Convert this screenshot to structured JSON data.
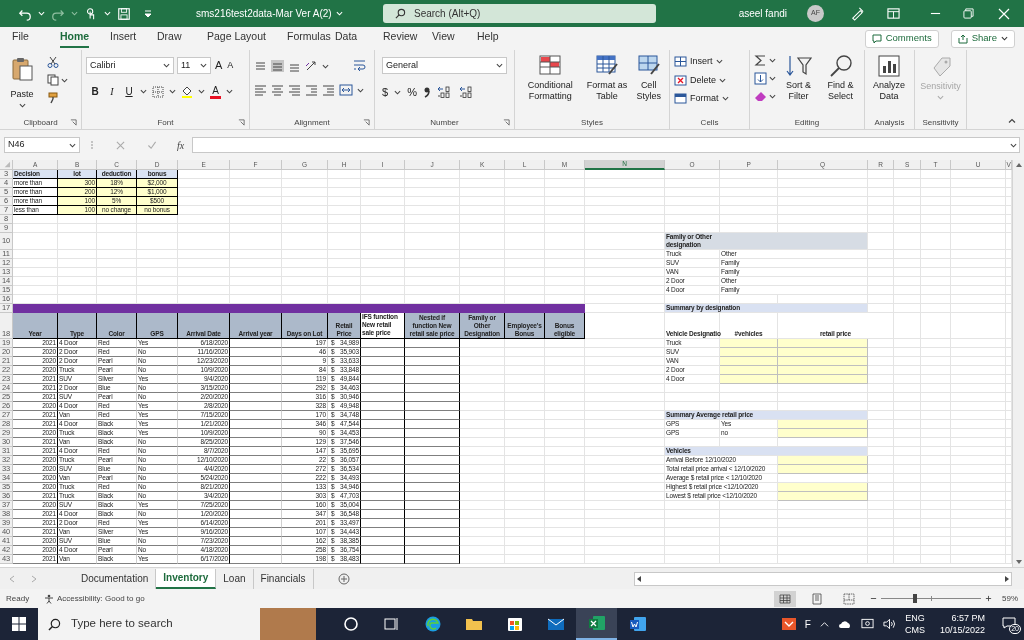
{
  "title_bar": {
    "document": "sms216test2data-Mar Ver A(2)",
    "search": "Search (Alt+Q)",
    "user": "aseel fandi",
    "initials": "AF"
  },
  "menu": [
    {
      "label": "File",
      "selected": false
    },
    {
      "label": "Home",
      "selected": true
    },
    {
      "label": "Insert",
      "selected": false
    },
    {
      "label": "Draw",
      "selected": false
    },
    {
      "label": "Page Layout",
      "selected": false
    },
    {
      "label": "Formulas",
      "selected": false
    },
    {
      "label": "Data",
      "selected": false
    },
    {
      "label": "Review",
      "selected": false
    },
    {
      "label": "View",
      "selected": false
    },
    {
      "label": "Help",
      "selected": false
    }
  ],
  "comments": "Comments",
  "share": "Share",
  "ribbon": {
    "clipboard": {
      "paste": "Paste",
      "label": "Clipboard"
    },
    "font": {
      "face": "Calibri",
      "size": "11",
      "grow": "A",
      "shrink": "A",
      "bold": "B",
      "italic": "I",
      "underline": "U",
      "color_button": "A",
      "label": "Font"
    },
    "alignment": {
      "label": "Alignment"
    },
    "number": {
      "format": "General",
      "currency": "$",
      "percent": "%",
      "label": "Number"
    },
    "styles": {
      "buttons": [
        "Conditional Formatting",
        "Format as Table",
        "Cell Styles"
      ],
      "label": "Styles"
    },
    "cells": {
      "buttons": [
        "Insert",
        "Delete",
        "Format"
      ],
      "label": "Cells"
    },
    "editing": {
      "buttons": [
        "Sort & Filter",
        "Find & Select"
      ],
      "label": "Editing"
    },
    "analysis": {
      "button": "Analyze Data",
      "label": "Analysis"
    },
    "sensitivity": {
      "button": "Sensitivity",
      "label": "Sensitivity",
      "disabled": true
    }
  },
  "formula_bar": {
    "name_box": "N46",
    "fx": "fx"
  },
  "sheet": {
    "columns": [
      {
        "label": "A",
        "selected": false
      },
      {
        "label": "B",
        "selected": false
      },
      {
        "label": "C",
        "selected": false
      },
      {
        "label": "D",
        "selected": false
      },
      {
        "label": "E",
        "selected": false
      },
      {
        "label": "F",
        "selected": false
      },
      {
        "label": "G",
        "selected": false
      },
      {
        "label": "H",
        "selected": false
      },
      {
        "label": "I",
        "selected": false
      },
      {
        "label": "J",
        "selected": false
      },
      {
        "label": "K",
        "selected": false
      },
      {
        "label": "L",
        "selected": false
      },
      {
        "label": "M",
        "selected": false
      },
      {
        "label": "N",
        "selected": true
      },
      {
        "label": "O",
        "selected": false
      },
      {
        "label": "P",
        "selected": false
      },
      {
        "label": "Q",
        "selected": false
      },
      {
        "label": "R",
        "selected": false
      },
      {
        "label": "S",
        "selected": false
      },
      {
        "label": "T",
        "selected": false
      },
      {
        "label": "U",
        "selected": false
      },
      {
        "label": "V",
        "selected": false
      }
    ],
    "rows": [
      {
        "n": "3",
        "kind": "lookup_head",
        "cells": {
          "A": "Decision",
          "B": "lot",
          "C": "deduction",
          "D": "bonus"
        }
      },
      {
        "n": "4",
        "kind": "lookup",
        "cells": {
          "A": "more than",
          "B": "300",
          "C": "18%",
          "D": "$2,000"
        }
      },
      {
        "n": "5",
        "kind": "lookup",
        "cells": {
          "A": "more than",
          "B": "200",
          "C": "12%",
          "D": "$1,000"
        }
      },
      {
        "n": "6",
        "kind": "lookup",
        "cells": {
          "A": "more than",
          "B": "100",
          "C": "5%",
          "D": "$500"
        }
      },
      {
        "n": "7",
        "kind": "lookup",
        "cells": {
          "A": "less than",
          "B": "100",
          "C": "no change",
          "D": "no bonus"
        }
      },
      {
        "n": "8"
      },
      {
        "n": "9"
      },
      {
        "n": "10",
        "kind": "tall",
        "cells": {
          "O": {
            "kind": "band",
            "text": "Family or Other designation"
          }
        }
      },
      {
        "n": "11",
        "cells": {
          "O": "Truck",
          "P": "Other"
        }
      },
      {
        "n": "12",
        "cells": {
          "O": "SUV",
          "P": "Family"
        }
      },
      {
        "n": "13",
        "cells": {
          "O": "VAN",
          "P": "Family"
        }
      },
      {
        "n": "14",
        "cells": {
          "O": "2 Door",
          "P": "Other"
        }
      },
      {
        "n": "15",
        "cells": {
          "O": "4 Door",
          "P": "Family"
        }
      },
      {
        "n": "16"
      },
      {
        "n": "17",
        "kind": "bar",
        "cells": {
          "O": {
            "kind": "band",
            "text": "Summary by designation"
          }
        }
      },
      {
        "n": "18",
        "kind": "table_head",
        "cells": {
          "A": "Year",
          "B": "Type",
          "C": "Color",
          "D": "GPS",
          "E": "Arrival Date",
          "F": "Arrival year",
          "G": "Days on Lot",
          "H": "Retail Price",
          "I": "IFS function New retail sale price",
          "J": "Nested if function New retail sale price",
          "K": "Family or Other Designation",
          "L": "Employee's Bonus",
          "M": "Bonus eligible",
          "O": "Vehicle Designatio",
          "P": "#vehicles",
          "Q": "retail price"
        }
      },
      {
        "n": "19",
        "kind": "record",
        "cells": {
          "A": "2021",
          "B": "4 Door",
          "C": "Red",
          "D": "Yes",
          "E": "6/18/2020",
          "G": "197",
          "H": {
            "currency": "$",
            "value": "34,989"
          },
          "O": "Truck",
          "P": {
            "kind": "input"
          },
          "Q": {
            "kind": "input"
          }
        }
      },
      {
        "n": "20",
        "kind": "record",
        "cells": {
          "A": "2020",
          "B": "2 Door",
          "C": "Red",
          "D": "No",
          "E": "11/16/2020",
          "G": "46",
          "H": {
            "currency": "$",
            "value": "35,903"
          },
          "O": "SUV",
          "P": {
            "kind": "input"
          },
          "Q": {
            "kind": "input"
          }
        }
      },
      {
        "n": "21",
        "kind": "record",
        "cells": {
          "A": "2020",
          "B": "2 Door",
          "C": "Pearl",
          "D": "No",
          "E": "12/23/2020",
          "G": "9",
          "H": {
            "currency": "$",
            "value": "33,633"
          },
          "O": "VAN",
          "P": {
            "kind": "input"
          },
          "Q": {
            "kind": "input"
          }
        }
      },
      {
        "n": "22",
        "kind": "record",
        "cells": {
          "A": "2020",
          "B": "Truck",
          "C": "Pearl",
          "D": "No",
          "E": "10/9/2020",
          "G": "84",
          "H": {
            "currency": "$",
            "value": "33,848"
          },
          "O": "2 Door",
          "P": {
            "kind": "input"
          },
          "Q": {
            "kind": "input"
          }
        }
      },
      {
        "n": "23",
        "kind": "record",
        "cells": {
          "A": "2021",
          "B": "SUV",
          "C": "Silver",
          "D": "Yes",
          "E": "9/4/2020",
          "G": "119",
          "H": {
            "currency": "$",
            "value": "49,844"
          },
          "O": "4 Door",
          "P": {
            "kind": "input"
          },
          "Q": {
            "kind": "input"
          }
        }
      },
      {
        "n": "24",
        "kind": "record",
        "cells": {
          "A": "2021",
          "B": "2 Door",
          "C": "Blue",
          "D": "No",
          "E": "3/15/2020",
          "G": "292",
          "H": {
            "currency": "$",
            "value": "34,463"
          }
        }
      },
      {
        "n": "25",
        "kind": "record",
        "cells": {
          "A": "2021",
          "B": "SUV",
          "C": "Pearl",
          "D": "No",
          "E": "2/20/2020",
          "G": "316",
          "H": {
            "currency": "$",
            "value": "30,946"
          }
        }
      },
      {
        "n": "26",
        "kind": "record",
        "cells": {
          "A": "2020",
          "B": "4 Door",
          "C": "Red",
          "D": "Yes",
          "E": "2/8/2020",
          "G": "328",
          "H": {
            "currency": "$",
            "value": "49,948"
          }
        }
      },
      {
        "n": "27",
        "kind": "record",
        "cells": {
          "A": "2021",
          "B": "Van",
          "C": "Red",
          "D": "Yes",
          "E": "7/15/2020",
          "G": "170",
          "H": {
            "currency": "$",
            "value": "34,748"
          },
          "O": {
            "kind": "band",
            "text": "Summary Average retail price"
          }
        }
      },
      {
        "n": "28",
        "kind": "record",
        "cells": {
          "A": "2021",
          "B": "4 Door",
          "C": "Black",
          "D": "Yes",
          "E": "1/21/2020",
          "G": "346",
          "H": {
            "currency": "$",
            "value": "47,544"
          },
          "O": "GPS",
          "P": "Yes",
          "Q": {
            "kind": "input"
          }
        }
      },
      {
        "n": "29",
        "kind": "record",
        "cells": {
          "A": "2020",
          "B": "Truck",
          "C": "Black",
          "D": "Yes",
          "E": "10/9/2020",
          "G": "90",
          "H": {
            "currency": "$",
            "value": "34,453"
          },
          "O": "GPS",
          "P": "no",
          "Q": {
            "kind": "input"
          }
        }
      },
      {
        "n": "30",
        "kind": "record",
        "cells": {
          "A": "2021",
          "B": "Van",
          "C": "Black",
          "D": "No",
          "E": "8/25/2020",
          "G": "129",
          "H": {
            "currency": "$",
            "value": "37,546"
          }
        }
      },
      {
        "n": "31",
        "kind": "record",
        "cells": {
          "A": "2021",
          "B": "4 Door",
          "C": "Red",
          "D": "No",
          "E": "8/7/2020",
          "G": "147",
          "H": {
            "currency": "$",
            "value": "35,695"
          },
          "O": {
            "kind": "band",
            "text": "Vehicles"
          }
        }
      },
      {
        "n": "32",
        "kind": "record",
        "cells": {
          "A": "2020",
          "B": "Truck",
          "C": "Pearl",
          "D": "No",
          "E": "12/10/2020",
          "G": "22",
          "H": {
            "currency": "$",
            "value": "36,057"
          },
          "O": "Arrival Before 12/10/2020",
          "Q": {
            "kind": "input"
          }
        }
      },
      {
        "n": "33",
        "kind": "record",
        "cells": {
          "A": "2020",
          "B": "SUV",
          "C": "Blue",
          "D": "No",
          "E": "4/4/2020",
          "G": "272",
          "H": {
            "currency": "$",
            "value": "36,534"
          },
          "O": "Total retail price arrival < 12/10/2020",
          "Q": {
            "kind": "input"
          }
        }
      },
      {
        "n": "34",
        "kind": "record",
        "cells": {
          "A": "2020",
          "B": "Van",
          "C": "Pearl",
          "D": "No",
          "E": "5/24/2020",
          "G": "222",
          "H": {
            "currency": "$",
            "value": "34,493"
          },
          "O": "Average $ retail price < 12/10/2020"
        }
      },
      {
        "n": "35",
        "kind": "record",
        "cells": {
          "A": "2020",
          "B": "Truck",
          "C": "Red",
          "D": "No",
          "E": "8/21/2020",
          "G": "133",
          "H": {
            "currency": "$",
            "value": "34,946"
          },
          "O": "Highest $ retail price <12/10/2020",
          "Q": {
            "kind": "input"
          }
        }
      },
      {
        "n": "36",
        "kind": "record",
        "cells": {
          "A": "2021",
          "B": "Truck",
          "C": "Black",
          "D": "No",
          "E": "3/4/2020",
          "G": "303",
          "H": {
            "currency": "$",
            "value": "47,703"
          },
          "O": "Lowest $ retail price <12/10/2020",
          "Q": {
            "kind": "input"
          }
        }
      },
      {
        "n": "37",
        "kind": "record",
        "cells": {
          "A": "2020",
          "B": "SUV",
          "C": "Black",
          "D": "Yes",
          "E": "7/25/2020",
          "G": "160",
          "H": {
            "currency": "$",
            "value": "35,004"
          }
        }
      },
      {
        "n": "38",
        "kind": "record",
        "cells": {
          "A": "2021",
          "B": "4 Door",
          "C": "Black",
          "D": "No",
          "E": "1/20/2020",
          "G": "347",
          "H": {
            "currency": "$",
            "value": "36,548"
          }
        }
      },
      {
        "n": "39",
        "kind": "record",
        "cells": {
          "A": "2021",
          "B": "2 Door",
          "C": "Red",
          "D": "Yes",
          "E": "6/14/2020",
          "G": "201",
          "H": {
            "currency": "$",
            "value": "33,497"
          }
        }
      },
      {
        "n": "40",
        "kind": "record",
        "cells": {
          "A": "2021",
          "B": "Van",
          "C": "Silver",
          "D": "Yes",
          "E": "9/16/2020",
          "G": "107",
          "H": {
            "currency": "$",
            "value": "34,443"
          }
        }
      },
      {
        "n": "41",
        "kind": "record",
        "cells": {
          "A": "2020",
          "B": "SUV",
          "C": "Blue",
          "D": "No",
          "E": "7/23/2020",
          "G": "162",
          "H": {
            "currency": "$",
            "value": "38,385"
          }
        }
      },
      {
        "n": "42",
        "kind": "record",
        "cells": {
          "A": "2020",
          "B": "4 Door",
          "C": "Pearl",
          "D": "No",
          "E": "4/18/2020",
          "G": "258",
          "H": {
            "currency": "$",
            "value": "36,754"
          }
        }
      },
      {
        "n": "43",
        "kind": "record",
        "cells": {
          "A": "2021",
          "B": "Van",
          "C": "Black",
          "D": "Yes",
          "E": "6/17/2020",
          "G": "198",
          "H": {
            "currency": "$",
            "value": "38,483"
          }
        }
      }
    ]
  },
  "sheet_tabs": [
    {
      "label": "Documentation",
      "selected": false
    },
    {
      "label": "Inventory",
      "selected": true
    },
    {
      "label": "Loan",
      "selected": false
    },
    {
      "label": "Financials",
      "selected": false
    }
  ],
  "status_bar": {
    "mode": "Ready",
    "accessibility": "Accessibility: Good to go",
    "views": [
      {
        "selected": true
      },
      {
        "selected": false
      },
      {
        "selected": false
      }
    ],
    "zoom": {
      "level": 0.34,
      "reading": "59%"
    }
  },
  "taskbar": {
    "search": {
      "placeholder": "Type here to search"
    },
    "apps": [
      {
        "selected": false
      },
      {
        "selected": false
      },
      {
        "selected": false
      },
      {
        "selected": false
      },
      {
        "selected": false
      },
      {
        "selected": false
      },
      {
        "selected": true
      },
      {
        "selected": false
      }
    ],
    "tray_letter": "F",
    "language": "ENG",
    "layout": "CMS",
    "time": "6:57 PM",
    "date": "10/15/2022",
    "notifications": "20"
  }
}
